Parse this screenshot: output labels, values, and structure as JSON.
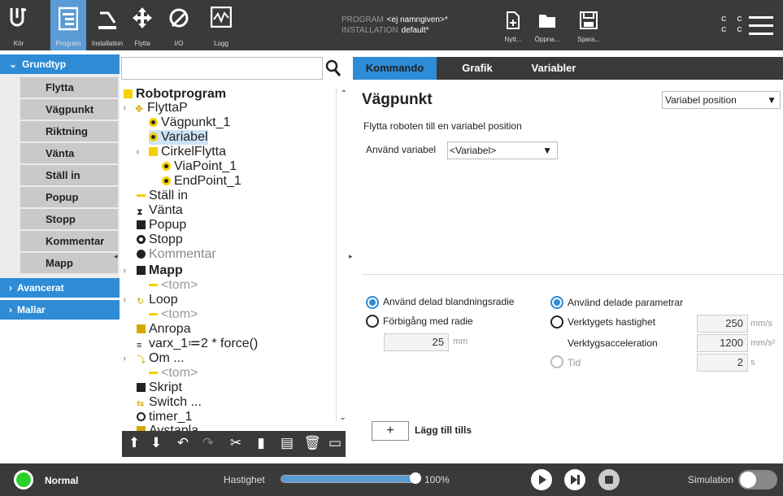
{
  "nav": {
    "run": "Kör",
    "program": "Program",
    "installation": "Installation",
    "move": "Flytta",
    "io": "I/O",
    "log": "Logg"
  },
  "header": {
    "program_label": "PROGRAM",
    "program_value": "<ej namngiven>*",
    "installation_label": "INSTALLATION",
    "installation_value": "default*",
    "new": "Nytt...",
    "open": "Öppna...",
    "save": "Spara...",
    "cc": "c c"
  },
  "sidebar": {
    "basic": "Grundtyp",
    "items": [
      "Flytta",
      "Vägpunkt",
      "Riktning",
      "Vänta",
      "Ställ in",
      "Popup",
      "Stopp",
      "Kommentar",
      "Mapp"
    ],
    "advanced": "Avancerat",
    "templates": "Mallar"
  },
  "search": {
    "placeholder": ""
  },
  "tree": [
    "Robotprogram",
    "FlyttaP",
    "Vägpunkt_1",
    "Variabel",
    "CirkelFlytta",
    "ViaPoint_1",
    "EndPoint_1",
    "Ställ in",
    "Vänta",
    "Popup",
    "Stopp",
    "Kommentar",
    "Mapp",
    "<tom>",
    "Loop",
    "<tom>",
    "Anropa",
    "varx_1≔2 * force()",
    "Om ...",
    "<tom>",
    "Skript",
    "Switch ...",
    "timer_1",
    "Avstapla"
  ],
  "tabs": [
    "Kommando",
    "Grafik",
    "Variabler"
  ],
  "main": {
    "title": "Vägpunkt",
    "select_value": "Variabel position",
    "description": "Flytta roboten till en variabel position",
    "use_variable": "Använd variabel",
    "variable_value": "<Variabel>",
    "blend_shared": "Använd delad blandningsradie",
    "blend_radius": "Förbigång med radie",
    "radius_value": "25",
    "radius_unit": "mm",
    "param_shared": "Använd delade parametrar",
    "tool_speed": "Verktygets hastighet",
    "speed_value": "250",
    "speed_unit": "mm/s",
    "tool_accel": "Verktygsacceleration",
    "accel_value": "1200",
    "accel_unit": "mm/s²",
    "time": "Tid",
    "time_value": "2",
    "time_unit": "s",
    "add": "Lägg till tills"
  },
  "bottom": {
    "status": "Normal",
    "speed_label": "Hastighet",
    "speed_value": "100%",
    "speed_fraction": 1.0,
    "simulation": "Simulation"
  },
  "colors": {
    "accent": "#2e8cd6",
    "dark": "#3a3a3a",
    "icon_yellow": "#f5d000"
  }
}
